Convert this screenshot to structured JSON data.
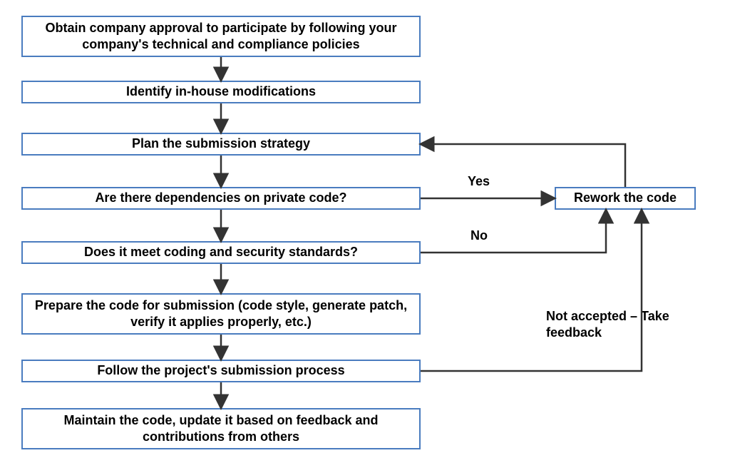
{
  "boxes": {
    "b1": "Obtain company approval to participate by following your company's technical and compliance policies",
    "b2": "Identify in-house modifications",
    "b3": "Plan the submission strategy",
    "b4": "Are there dependencies on private code?",
    "b5": "Does it meet coding and security standards?",
    "b6": "Prepare the code for submission (code style, generate patch, verify it applies properly, etc.)",
    "b7": "Follow the project's submission process",
    "b8": "Maintain the code, update it based on feedback and contributions from others",
    "rework": "Rework the code"
  },
  "labels": {
    "yes": "Yes",
    "no": "No",
    "not_accepted": "Not accepted – Take feedback"
  }
}
